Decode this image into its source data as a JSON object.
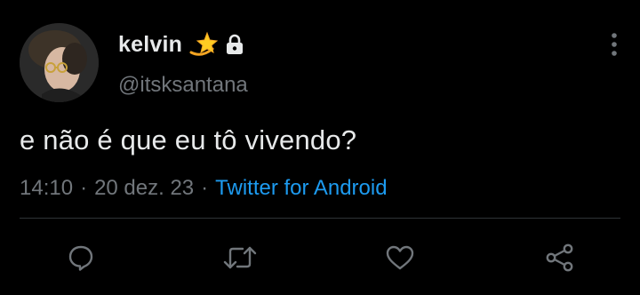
{
  "user": {
    "display_name": "kelvin",
    "handle": "@itsksantana",
    "badge_icon": "dizzy-star-emoji",
    "lock_icon": "lock-icon"
  },
  "tweet": {
    "text": "e não é que eu tô vivendo?",
    "time": "14:10",
    "separator": "·",
    "date": "20 dez. 23",
    "source": "Twitter for Android"
  },
  "actions": {
    "reply_icon": "reply-icon",
    "retweet_icon": "retweet-icon",
    "like_icon": "heart-icon",
    "share_icon": "share-icon"
  },
  "colors": {
    "background": "#000000",
    "text": "#e7e9ea",
    "secondary": "#71767b",
    "accent": "#1d9bf0",
    "divider": "#2f3336"
  }
}
